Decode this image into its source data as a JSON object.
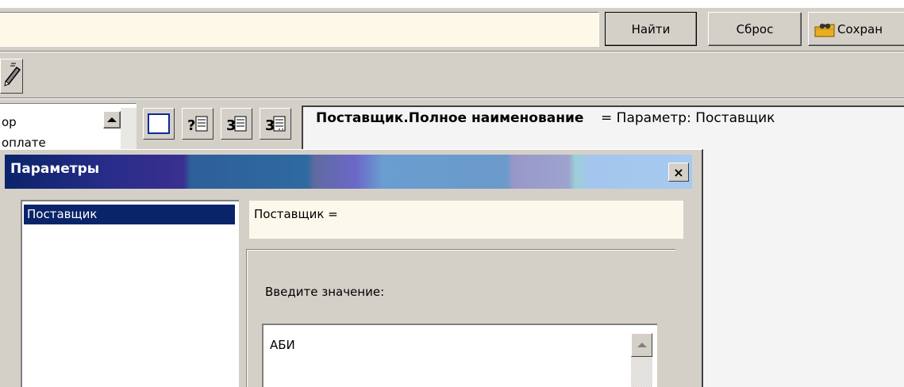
{
  "toolbar": {
    "find_label": "Найти",
    "reset_label": "Сброс",
    "save_label": "Сохран"
  },
  "left_list": {
    "items": [
      "ор",
      "оплате"
    ]
  },
  "field_panel": {
    "field_name": "Поставщик.Полное наименование",
    "condition": "= Параметр: Поставщик"
  },
  "dialog": {
    "title": "Параметры",
    "close_label": "×",
    "params": [
      "Поставщик"
    ],
    "expression": "Поставщик =",
    "prompt": "Введите значение:",
    "value": "АБИ"
  }
}
